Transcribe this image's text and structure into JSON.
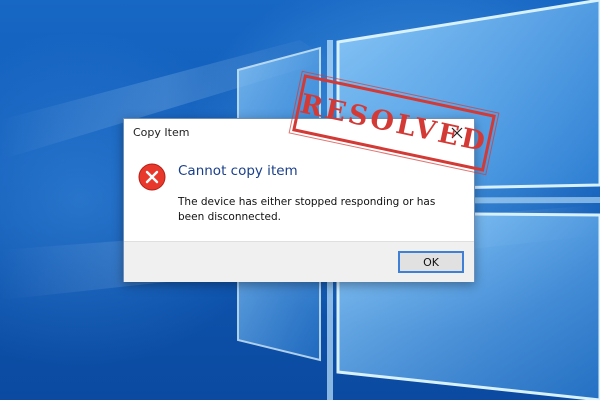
{
  "dialog": {
    "title": "Copy Item",
    "heading": "Cannot copy item",
    "message": "The device has either stopped responding or has been disconnected.",
    "ok_label": "OK",
    "close_icon": "close-icon",
    "error_icon": "error-icon"
  },
  "stamp": {
    "text": "RESOLVED",
    "color": "#d33a35"
  },
  "colors": {
    "accent": "#3f7fd6",
    "heading": "#1a3f8a",
    "error": "#e8382c"
  }
}
